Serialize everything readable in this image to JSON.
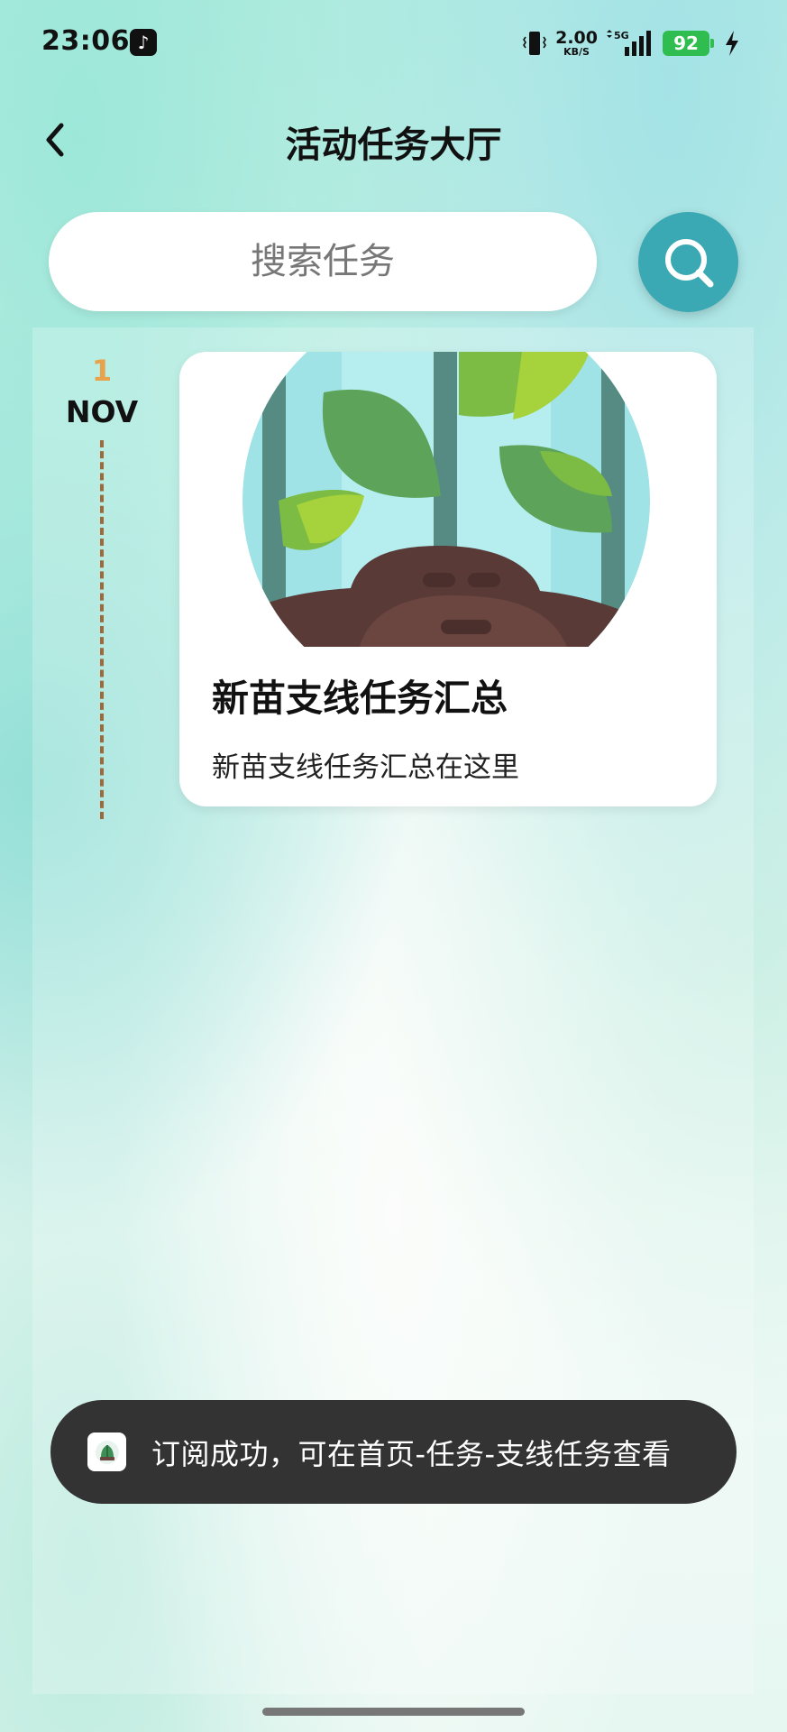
{
  "status_bar": {
    "time": "23:06",
    "app_icon": "tiktok-icon",
    "net_speed": "2.00",
    "net_speed_unit": "KB/S",
    "signal_label": "5G",
    "battery": "92"
  },
  "header": {
    "back_icon": "chevron-left-icon",
    "title": "活动任务大厅"
  },
  "search": {
    "placeholder": "搜索任务",
    "button_icon": "search-icon"
  },
  "timeline": {
    "day": "1",
    "month": "NOV"
  },
  "task_card": {
    "image": "seedling-plant-illustration",
    "title": "新苗支线任务汇总",
    "description": "新苗支线任务汇总在这里"
  },
  "toast": {
    "icon": "app-logo-icon",
    "message": "订阅成功，可在首页-任务-支线任务查看"
  },
  "colors": {
    "accent": "#3aa9b4",
    "timeline_day": "#e8a24c",
    "timeline_line": "#a0693a",
    "toast_bg": "#333333",
    "battery": "#2fbd4f"
  }
}
